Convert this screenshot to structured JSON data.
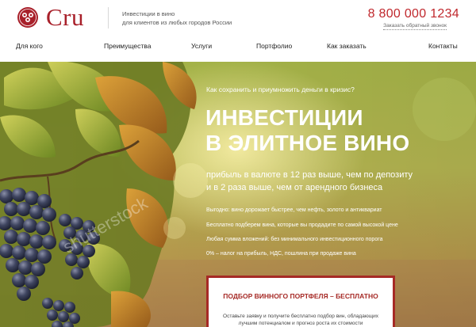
{
  "header": {
    "brand": "Cru",
    "tagline_line1": "Инвестиции в вино",
    "tagline_line2": "для клиентов из любых городов России",
    "phone": "8 800 000 1234",
    "callback_label": "Заказать обратный звонок"
  },
  "nav": {
    "items": [
      "Для кого",
      "Преимущества",
      "Услуги",
      "Портфолио",
      "Как заказать",
      "Контакты"
    ]
  },
  "hero": {
    "question": "Как сохранить и приумножить деньги в кризис?",
    "title_line1": "ИНВЕСТИЦИИ",
    "title_line2": "В ЭЛИТНОЕ ВИНО",
    "subtitle_line1": "прибыль в валюте в 12 раз выше, чем по депозиту",
    "subtitle_line2": "и в 2 раза выше, чем от арендного бизнеса",
    "benefits": [
      "Выгодно: вино дорожает быстрее, чем нефть, золото и антиквариат",
      "Бесплатно подберем вина, которые вы продадите по самой высокой цене",
      "Любая сумма вложений: без минимального инвестиционного порога",
      "0% – налог на прибыль, НДС, пошлина при продаже вина"
    ]
  },
  "cta": {
    "title": "ПОДБОР ВИННОГО ПОРТФЕЛЯ – БЕСПЛАТНО",
    "desc_line1": "Оставьте заявку и получите бесплатно подбор вин, обладающих",
    "desc_line2": "лучшим потенциалом и прогноз роста их стоимости"
  },
  "watermark": "shutterstock",
  "colors": {
    "brand_red": "#a8202a",
    "phone_red": "#c0282d",
    "cta_border": "#a62a26"
  }
}
